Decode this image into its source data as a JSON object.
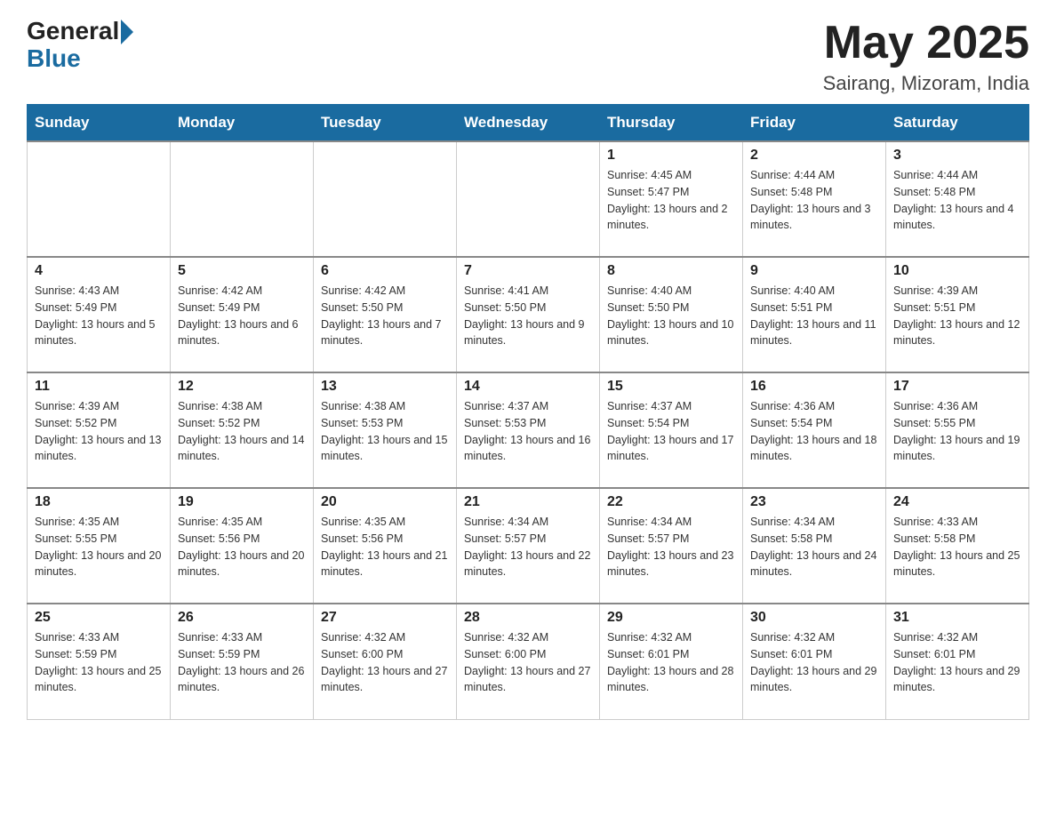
{
  "header": {
    "logo_general": "General",
    "logo_blue": "Blue",
    "month_year": "May 2025",
    "location": "Sairang, Mizoram, India"
  },
  "weekdays": [
    "Sunday",
    "Monday",
    "Tuesday",
    "Wednesday",
    "Thursday",
    "Friday",
    "Saturday"
  ],
  "weeks": [
    [
      {
        "day": "",
        "sunrise": "",
        "sunset": "",
        "daylight": ""
      },
      {
        "day": "",
        "sunrise": "",
        "sunset": "",
        "daylight": ""
      },
      {
        "day": "",
        "sunrise": "",
        "sunset": "",
        "daylight": ""
      },
      {
        "day": "",
        "sunrise": "",
        "sunset": "",
        "daylight": ""
      },
      {
        "day": "1",
        "sunrise": "Sunrise: 4:45 AM",
        "sunset": "Sunset: 5:47 PM",
        "daylight": "Daylight: 13 hours and 2 minutes."
      },
      {
        "day": "2",
        "sunrise": "Sunrise: 4:44 AM",
        "sunset": "Sunset: 5:48 PM",
        "daylight": "Daylight: 13 hours and 3 minutes."
      },
      {
        "day": "3",
        "sunrise": "Sunrise: 4:44 AM",
        "sunset": "Sunset: 5:48 PM",
        "daylight": "Daylight: 13 hours and 4 minutes."
      }
    ],
    [
      {
        "day": "4",
        "sunrise": "Sunrise: 4:43 AM",
        "sunset": "Sunset: 5:49 PM",
        "daylight": "Daylight: 13 hours and 5 minutes."
      },
      {
        "day": "5",
        "sunrise": "Sunrise: 4:42 AM",
        "sunset": "Sunset: 5:49 PM",
        "daylight": "Daylight: 13 hours and 6 minutes."
      },
      {
        "day": "6",
        "sunrise": "Sunrise: 4:42 AM",
        "sunset": "Sunset: 5:50 PM",
        "daylight": "Daylight: 13 hours and 7 minutes."
      },
      {
        "day": "7",
        "sunrise": "Sunrise: 4:41 AM",
        "sunset": "Sunset: 5:50 PM",
        "daylight": "Daylight: 13 hours and 9 minutes."
      },
      {
        "day": "8",
        "sunrise": "Sunrise: 4:40 AM",
        "sunset": "Sunset: 5:50 PM",
        "daylight": "Daylight: 13 hours and 10 minutes."
      },
      {
        "day": "9",
        "sunrise": "Sunrise: 4:40 AM",
        "sunset": "Sunset: 5:51 PM",
        "daylight": "Daylight: 13 hours and 11 minutes."
      },
      {
        "day": "10",
        "sunrise": "Sunrise: 4:39 AM",
        "sunset": "Sunset: 5:51 PM",
        "daylight": "Daylight: 13 hours and 12 minutes."
      }
    ],
    [
      {
        "day": "11",
        "sunrise": "Sunrise: 4:39 AM",
        "sunset": "Sunset: 5:52 PM",
        "daylight": "Daylight: 13 hours and 13 minutes."
      },
      {
        "day": "12",
        "sunrise": "Sunrise: 4:38 AM",
        "sunset": "Sunset: 5:52 PM",
        "daylight": "Daylight: 13 hours and 14 minutes."
      },
      {
        "day": "13",
        "sunrise": "Sunrise: 4:38 AM",
        "sunset": "Sunset: 5:53 PM",
        "daylight": "Daylight: 13 hours and 15 minutes."
      },
      {
        "day": "14",
        "sunrise": "Sunrise: 4:37 AM",
        "sunset": "Sunset: 5:53 PM",
        "daylight": "Daylight: 13 hours and 16 minutes."
      },
      {
        "day": "15",
        "sunrise": "Sunrise: 4:37 AM",
        "sunset": "Sunset: 5:54 PM",
        "daylight": "Daylight: 13 hours and 17 minutes."
      },
      {
        "day": "16",
        "sunrise": "Sunrise: 4:36 AM",
        "sunset": "Sunset: 5:54 PM",
        "daylight": "Daylight: 13 hours and 18 minutes."
      },
      {
        "day": "17",
        "sunrise": "Sunrise: 4:36 AM",
        "sunset": "Sunset: 5:55 PM",
        "daylight": "Daylight: 13 hours and 19 minutes."
      }
    ],
    [
      {
        "day": "18",
        "sunrise": "Sunrise: 4:35 AM",
        "sunset": "Sunset: 5:55 PM",
        "daylight": "Daylight: 13 hours and 20 minutes."
      },
      {
        "day": "19",
        "sunrise": "Sunrise: 4:35 AM",
        "sunset": "Sunset: 5:56 PM",
        "daylight": "Daylight: 13 hours and 20 minutes."
      },
      {
        "day": "20",
        "sunrise": "Sunrise: 4:35 AM",
        "sunset": "Sunset: 5:56 PM",
        "daylight": "Daylight: 13 hours and 21 minutes."
      },
      {
        "day": "21",
        "sunrise": "Sunrise: 4:34 AM",
        "sunset": "Sunset: 5:57 PM",
        "daylight": "Daylight: 13 hours and 22 minutes."
      },
      {
        "day": "22",
        "sunrise": "Sunrise: 4:34 AM",
        "sunset": "Sunset: 5:57 PM",
        "daylight": "Daylight: 13 hours and 23 minutes."
      },
      {
        "day": "23",
        "sunrise": "Sunrise: 4:34 AM",
        "sunset": "Sunset: 5:58 PM",
        "daylight": "Daylight: 13 hours and 24 minutes."
      },
      {
        "day": "24",
        "sunrise": "Sunrise: 4:33 AM",
        "sunset": "Sunset: 5:58 PM",
        "daylight": "Daylight: 13 hours and 25 minutes."
      }
    ],
    [
      {
        "day": "25",
        "sunrise": "Sunrise: 4:33 AM",
        "sunset": "Sunset: 5:59 PM",
        "daylight": "Daylight: 13 hours and 25 minutes."
      },
      {
        "day": "26",
        "sunrise": "Sunrise: 4:33 AM",
        "sunset": "Sunset: 5:59 PM",
        "daylight": "Daylight: 13 hours and 26 minutes."
      },
      {
        "day": "27",
        "sunrise": "Sunrise: 4:32 AM",
        "sunset": "Sunset: 6:00 PM",
        "daylight": "Daylight: 13 hours and 27 minutes."
      },
      {
        "day": "28",
        "sunrise": "Sunrise: 4:32 AM",
        "sunset": "Sunset: 6:00 PM",
        "daylight": "Daylight: 13 hours and 27 minutes."
      },
      {
        "day": "29",
        "sunrise": "Sunrise: 4:32 AM",
        "sunset": "Sunset: 6:01 PM",
        "daylight": "Daylight: 13 hours and 28 minutes."
      },
      {
        "day": "30",
        "sunrise": "Sunrise: 4:32 AM",
        "sunset": "Sunset: 6:01 PM",
        "daylight": "Daylight: 13 hours and 29 minutes."
      },
      {
        "day": "31",
        "sunrise": "Sunrise: 4:32 AM",
        "sunset": "Sunset: 6:01 PM",
        "daylight": "Daylight: 13 hours and 29 minutes."
      }
    ]
  ]
}
